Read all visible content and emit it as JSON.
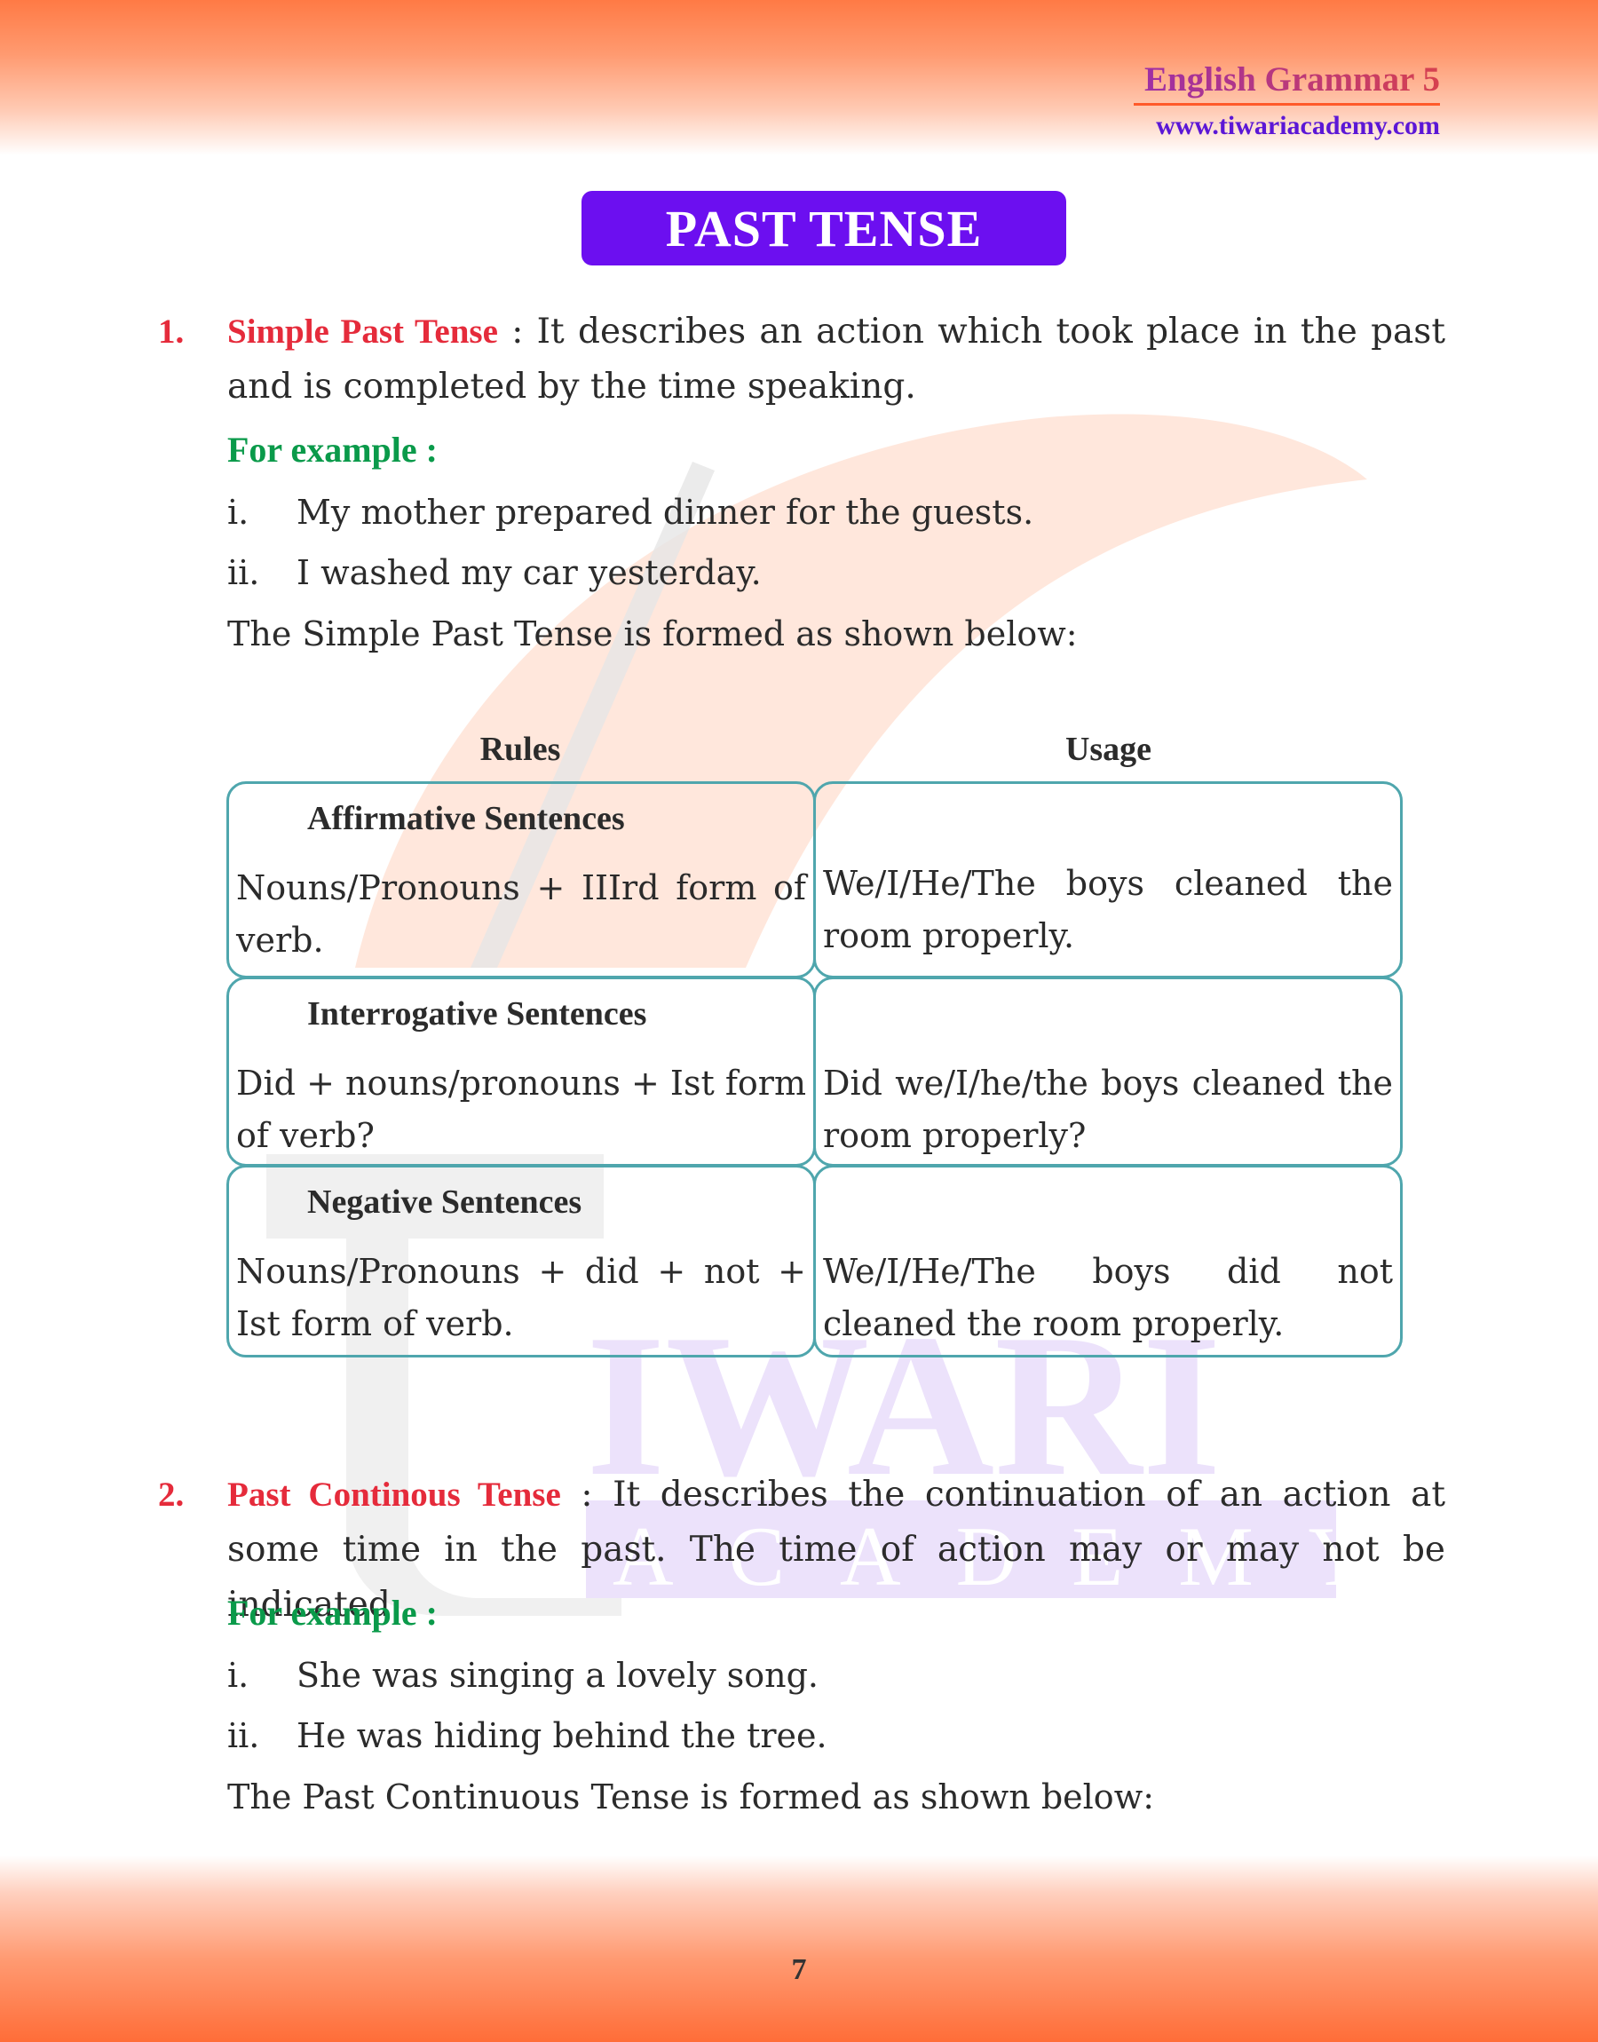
{
  "header": {
    "book_title": "English Grammar 5",
    "website": "www.tiwariacademy.com"
  },
  "page_title": "PAST TENSE",
  "sections": [
    {
      "number": "1.",
      "term": "Simple Past Tense",
      "separator": " : ",
      "definition": "It describes an action which took place in the past and is completed by the time speaking.",
      "example_label": "For example :",
      "examples": [
        {
          "marker": "i.",
          "text": "My mother prepared dinner for the guests."
        },
        {
          "marker": "ii.",
          "text": "I washed my car yesterday."
        }
      ],
      "formation_note": "The Simple Past Tense is formed as shown below:",
      "table": {
        "headers": [
          "Rules",
          "Usage"
        ],
        "rows": [
          {
            "type": "Affirmative Sentences",
            "rule": "Nouns/Pronouns + IIIrd form of verb.",
            "usage": "We/I/He/The boys cleaned the room properly."
          },
          {
            "type": "Interrogative Sentences",
            "rule": "Did + nouns/pronouns + Ist form of verb?",
            "usage": "Did we/I/he/the boys cleaned the room properly?"
          },
          {
            "type": "Negative Sentences",
            "rule": "Nouns/Pronouns + did + not + Ist form of verb.",
            "usage": "We/I/He/The boys did not cleaned the room properly."
          }
        ]
      }
    },
    {
      "number": "2.",
      "term": "Past Continous Tense",
      "separator": " : ",
      "definition": "It describes the continuation of an action at some time in the past. The time of action may or may not be indicated.",
      "example_label": "For example :",
      "examples": [
        {
          "marker": "i.",
          "text": "She was singing a lovely song."
        },
        {
          "marker": "ii.",
          "text": "He was hiding behind the tree."
        }
      ],
      "formation_note": "The Past Continuous Tense is formed as shown below:"
    }
  ],
  "watermark": {
    "word1": "IWARI",
    "word2": "ACADEMY"
  },
  "footer": {
    "page_number": "7"
  },
  "colors": {
    "title_box": "#6c0ff0",
    "term_red": "#e52b3b",
    "example_green": "#0a9a4a",
    "table_border": "#4fa6ad",
    "band_orange": "#ff7a45"
  }
}
